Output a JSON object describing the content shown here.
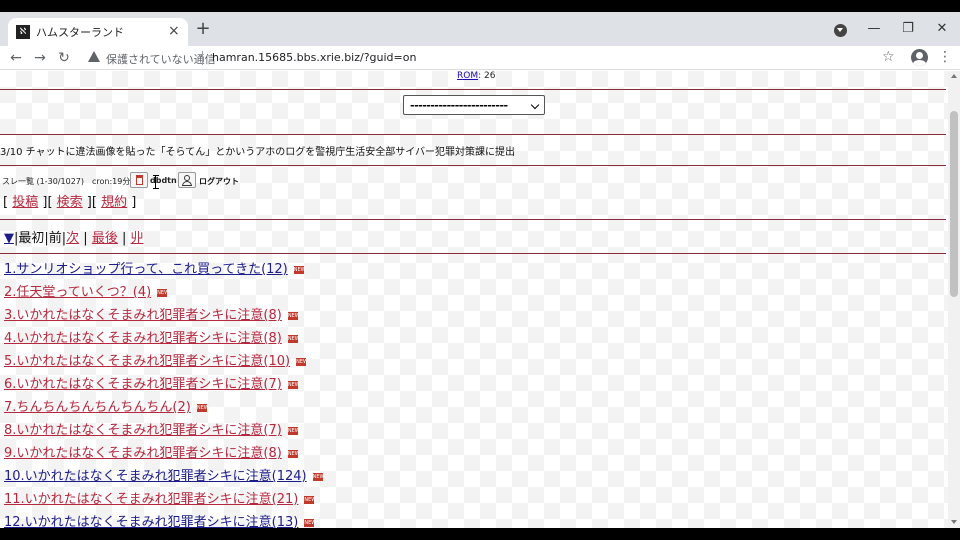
{
  "browser": {
    "tab_title": "ハムスターランド",
    "favicon_text": "ℵ",
    "close_glyph": "×",
    "newtab_glyph": "+",
    "min_glyph": "—",
    "max_glyph": "❐",
    "winclose_glyph": "✕",
    "back_glyph": "←",
    "forward_glyph": "→",
    "reload_glyph": "↻",
    "security_text": "保護されていない通信",
    "url": "hamran.15685.bbs.xrie.biz/?guid=on",
    "star_glyph": "☆",
    "menu_glyph": "⋮"
  },
  "page": {
    "rom_label": "ROM",
    "rom_count": ": 26",
    "select_value": "------------------------",
    "notice": "3/10 チャットに違法画像を貼った「そらてん」とかいうアホのログを警視庁生活安全部サイバー犯罪対策課に提出",
    "status_text": "スレ一覧 (1-30/1027)　cron:19分",
    "user_name": "dbdtn",
    "logout_label": "ログアウト",
    "links": {
      "open": "[ ",
      "post": "投稿",
      "sep1": " ][ ",
      "search": "検索",
      "sep2": " ][ ",
      "rules": "規約",
      "close": " ]"
    },
    "pager": {
      "arrow": "▼",
      "first": "|最初|前|",
      "next": "次",
      "sep": " | ",
      "last": "最後",
      "sep2": " | ",
      "mark": "丱"
    },
    "threads": [
      {
        "label": "1.サンリオショップ行って、これ買ってきた(12)",
        "color": "navy"
      },
      {
        "label": "2.任天堂っていくつ？(4)",
        "color": "pink"
      },
      {
        "label": "3.いかれたはなくそまみれ犯罪者シキに注意(8)",
        "color": "pink"
      },
      {
        "label": "4.いかれたはなくそまみれ犯罪者シキに注意(8)",
        "color": "pink"
      },
      {
        "label": "5.いかれたはなくそまみれ犯罪者シキに注意(10)",
        "color": "pink"
      },
      {
        "label": "6.いかれたはなくそまみれ犯罪者シキに注意(7)",
        "color": "pink"
      },
      {
        "label": "7.ちんちんちんちんちんちん(2)",
        "color": "pink"
      },
      {
        "label": "8.いかれたはなくそまみれ犯罪者シキに注意(7)",
        "color": "pink"
      },
      {
        "label": "9.いかれたはなくそまみれ犯罪者シキに注意(8)",
        "color": "pink"
      },
      {
        "label": "10.いかれたはなくそまみれ犯罪者シキに注意(124)",
        "color": "navy"
      },
      {
        "label": "11.いかれたはなくそまみれ犯罪者シキに注意(21)",
        "color": "pink"
      },
      {
        "label": "12.いかれたはなくそまみれ犯罪者シキに注意(13)",
        "color": "navy"
      }
    ]
  }
}
